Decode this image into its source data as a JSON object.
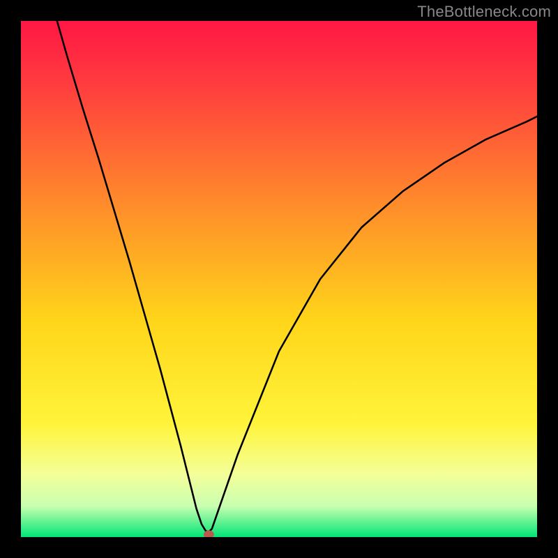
{
  "watermark": "TheBottleneck.com",
  "chart_data": {
    "type": "line",
    "title": "",
    "xlabel": "",
    "ylabel": "",
    "xlim": [
      0,
      100
    ],
    "ylim": [
      0,
      100
    ],
    "grid": false,
    "legend": false,
    "background_gradient": {
      "top_color": "#ff1744",
      "mid_color": "#ffe400",
      "bottom_color": "#00e676"
    },
    "series": [
      {
        "name": "bottleneck-curve",
        "color": "#000000",
        "x": [
          7.0,
          9.0,
          12.0,
          15.0,
          18.0,
          21.0,
          24.0,
          27.0,
          29.0,
          31.0,
          32.5,
          34.0,
          35.0,
          35.8,
          36.4,
          37.0,
          42.0,
          50.0,
          58.0,
          66.0,
          74.0,
          82.0,
          90.0,
          98.0,
          100.0
        ],
        "values": [
          100.0,
          93.0,
          83.0,
          73.5,
          63.5,
          53.5,
          43.0,
          32.5,
          25.0,
          17.5,
          11.5,
          5.5,
          2.5,
          1.2,
          1.0,
          1.6,
          16.0,
          36.0,
          50.0,
          60.0,
          67.0,
          72.5,
          77.0,
          80.5,
          81.5
        ]
      }
    ],
    "marker": {
      "name": "optimal-point",
      "x": 36.4,
      "y": 0.5,
      "color": "#bb5a4a",
      "rx": 1.0,
      "ry": 0.8
    }
  }
}
